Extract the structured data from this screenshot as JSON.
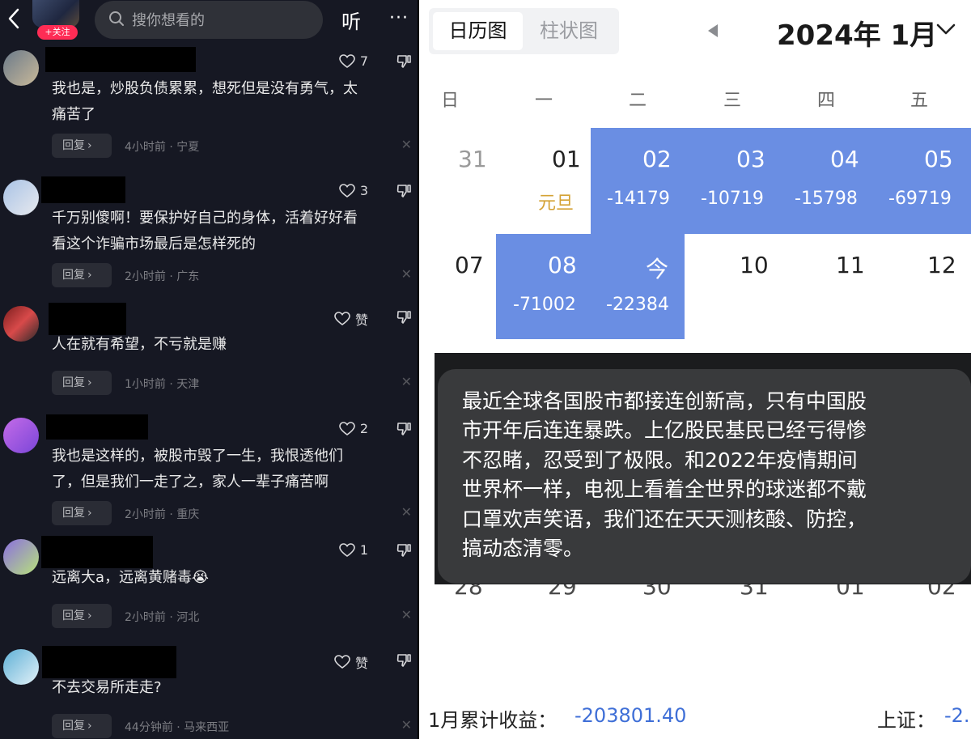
{
  "left": {
    "follow_badge": "+关注",
    "search_placeholder": "搜你想看的",
    "listen_label": "听",
    "more_label": "···",
    "comments": [
      {
        "likes": "7",
        "lines": [
          "我也是，炒股负债累累，想死但是没有勇气，太",
          "痛苦了"
        ],
        "reply": "回复",
        "meta": "4小时前 · 宁夏"
      },
      {
        "likes": "3",
        "lines": [
          "千万别傻啊！要保护好自己的身体，活着好好看",
          "看这个诈骗市场最后是怎样死的"
        ],
        "reply": "回复",
        "meta": "2小时前 · 广东"
      },
      {
        "likes": "赞",
        "lines": [
          "人在就有希望，不亏就是赚"
        ],
        "reply": "回复",
        "meta": "1小时前 · 天津"
      },
      {
        "likes": "2",
        "lines": [
          "我也是这样的，被股市毁了一生，我恨透他们",
          "了，但是我们一走了之，家人一辈子痛苦啊"
        ],
        "reply": "回复",
        "meta": "2小时前 · 重庆"
      },
      {
        "likes": "1",
        "lines": [
          "远离大a，远离黄赌毒😭"
        ],
        "reply": "回复",
        "meta": "2小时前 · 河北"
      },
      {
        "likes": "赞",
        "lines": [
          "不去交易所走走?"
        ],
        "reply": "回复",
        "meta": "44分钟前 · 马来西亚"
      }
    ]
  },
  "right": {
    "tab_calendar": "日历图",
    "tab_bar": "柱状图",
    "month_title": "2024年 1月",
    "weekdays": [
      "日",
      "一",
      "二",
      "三",
      "四",
      "五"
    ],
    "week1": [
      {
        "day": "31",
        "sub": ""
      },
      {
        "day": "01",
        "sub": "元旦"
      },
      {
        "day": "02",
        "sub": "-14179"
      },
      {
        "day": "03",
        "sub": "-10719"
      },
      {
        "day": "04",
        "sub": "-15798"
      },
      {
        "day": "05",
        "sub": "-69719"
      }
    ],
    "week2": [
      {
        "day": "07",
        "sub": ""
      },
      {
        "day": "08",
        "sub": "-71002"
      },
      {
        "day": "今",
        "sub": "-22384"
      },
      {
        "day": "10",
        "sub": ""
      },
      {
        "day": "11",
        "sub": ""
      },
      {
        "day": "12",
        "sub": ""
      }
    ],
    "bubble_lines": [
      "最近全球各国股市都接连创新高，只有中国股",
      "市开年后连连暴跌。上亿股民基民已经亏得惨",
      "不忍睹，忍受到了极限。和2022年疫情期间",
      "世界杯一样，电视上看着全世界的球迷都不戴",
      "口罩欢声笑语，我们还在天天测核酸、防控，",
      "搞动态清零。"
    ],
    "ghost_days": [
      "28",
      "29",
      "30",
      "31",
      "01",
      "02"
    ],
    "footer_label": "1月累计收益：",
    "footer_value": "-203801.40",
    "index_label": "上证：",
    "index_value": "-2.",
    "colors": {
      "highlight": "#6a8ee3",
      "negative": "#3f6fd7",
      "holiday": "#d4a235",
      "bubble": "#393a3c"
    }
  }
}
